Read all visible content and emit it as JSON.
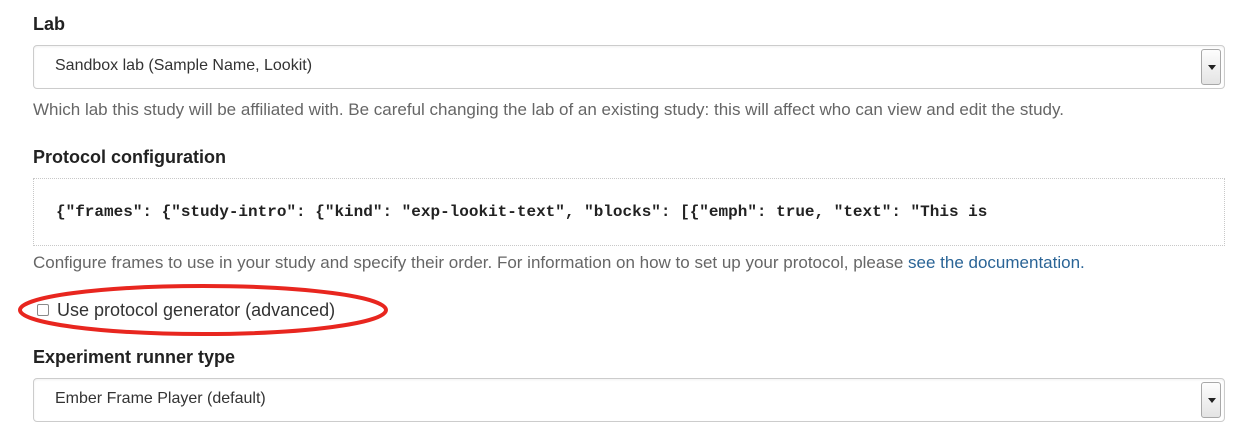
{
  "lab": {
    "label": "Lab",
    "selected": "Sandbox lab (Sample Name, Lookit)",
    "help": "Which lab this study will be affiliated with. Be careful changing the lab of an existing study: this will affect who can view and edit the study."
  },
  "protocol": {
    "label": "Protocol configuration",
    "value": "{\"frames\": {\"study-intro\": {\"kind\": \"exp-lookit-text\", \"blocks\": [{\"emph\": true, \"text\": \"This is",
    "help_prefix": "Configure frames to use in your study and specify their order. For information on how to set up your protocol, please ",
    "help_link": "see the documentation."
  },
  "generator": {
    "label": "Use protocol generator (advanced)",
    "checked": false
  },
  "runner": {
    "label": "Experiment runner type",
    "selected": "Ember Frame Player (default)"
  },
  "colors": {
    "link": "#2a6496",
    "highlight_ellipse": "#e8261f"
  }
}
